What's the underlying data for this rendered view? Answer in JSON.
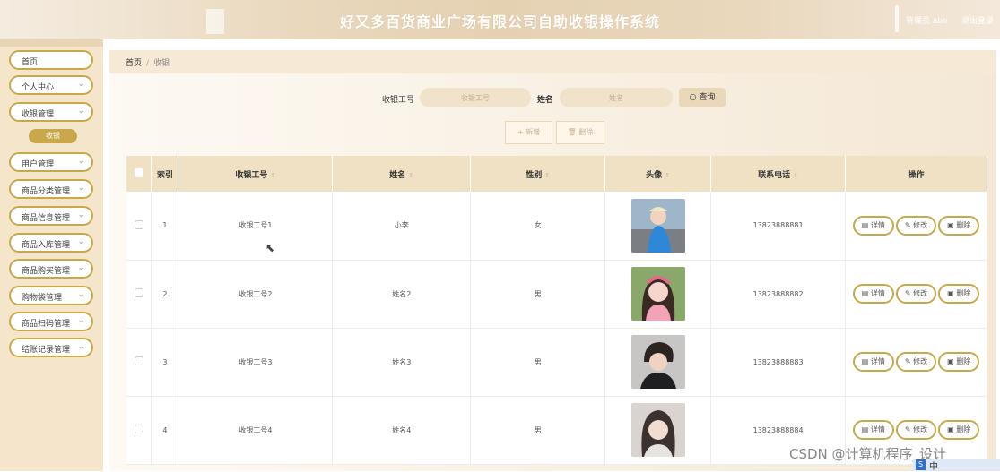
{
  "header": {
    "title": "好又多百货商业广场有限公司自助收银操作系统",
    "user": "管理员 abo",
    "logout": "退出登录"
  },
  "sidebar": {
    "items": [
      {
        "label": "首页"
      },
      {
        "label": "个人中心"
      },
      {
        "label": "收银管理"
      },
      {
        "label": "用户管理"
      },
      {
        "label": "商品分类管理"
      },
      {
        "label": "商品信息管理"
      },
      {
        "label": "商品入库管理"
      },
      {
        "label": "商品购买管理"
      },
      {
        "label": "购物袋管理"
      },
      {
        "label": "商品扫码管理"
      },
      {
        "label": "结账记录管理"
      }
    ],
    "sub_active": "收银"
  },
  "breadcrumb": {
    "home": "首页",
    "sep": "/",
    "current": "收银"
  },
  "search": {
    "label1": "收银工号",
    "placeholder1": "收银工号",
    "label2": "姓名",
    "placeholder2": "姓名",
    "query_button": "查询"
  },
  "actions": {
    "add": "+ 新增",
    "delete": "删除"
  },
  "table": {
    "headers": [
      "索引",
      "收银工号",
      "姓名",
      "性别",
      "头像",
      "联系电话",
      "操作"
    ],
    "rows": [
      {
        "index": "1",
        "code": "收银工号1",
        "name": "小李",
        "gender": "女",
        "phone": "13823888881"
      },
      {
        "index": "2",
        "code": "收银工号2",
        "name": "姓名2",
        "gender": "男",
        "phone": "13823888882"
      },
      {
        "index": "3",
        "code": "收银工号3",
        "name": "姓名3",
        "gender": "男",
        "phone": "13823888883"
      },
      {
        "index": "4",
        "code": "收银工号4",
        "name": "姓名4",
        "gender": "男",
        "phone": "13823888884"
      }
    ],
    "op_labels": {
      "detail": "详情",
      "edit": "修改",
      "delete": "删除"
    }
  },
  "watermark": "CSDN @计算机程序_设计",
  "tray": {
    "ime": "中"
  }
}
